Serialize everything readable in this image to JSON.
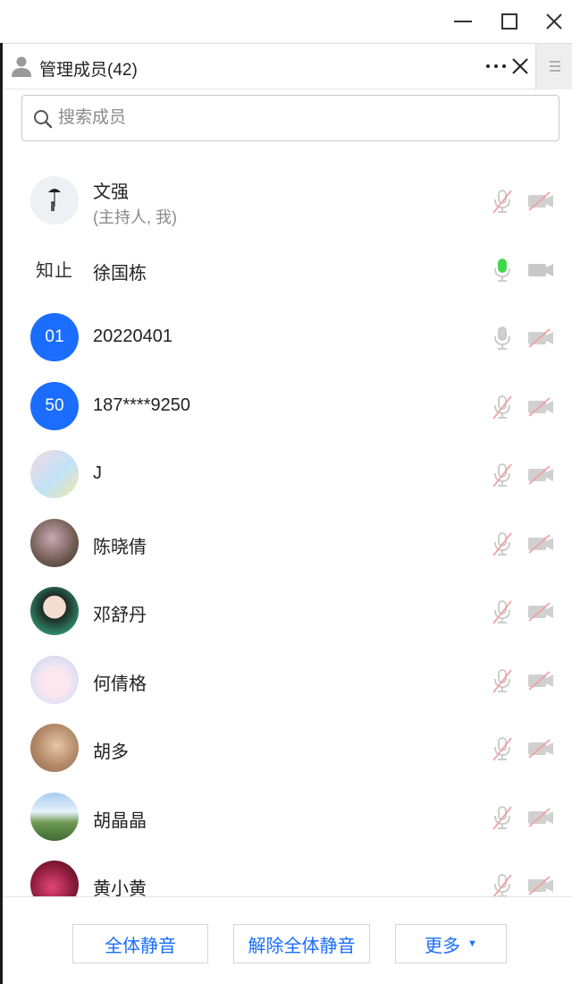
{
  "window": {
    "minimize_icon": "minimize-icon",
    "maximize_icon": "maximize-icon",
    "close_icon": "close-icon"
  },
  "header": {
    "title": "管理成员(42)",
    "user_icon": "user-icon",
    "more_icon": "more-horizontal-icon",
    "close_icon": "close-icon",
    "side_icon": "menu-icon"
  },
  "search": {
    "placeholder": "搜索成员",
    "value": "",
    "icon": "search-icon"
  },
  "members": [
    {
      "name": "文强",
      "sub": "(主持人, 我)",
      "mic": "muted",
      "camera": "off"
    },
    {
      "name": "徐国栋",
      "avatar_text": "知止",
      "mic": "active",
      "camera": "on"
    },
    {
      "name": "20220401",
      "avatar_text": "01",
      "mic": "on",
      "camera": "off"
    },
    {
      "name": "187****9250",
      "avatar_text": "50",
      "mic": "muted",
      "camera": "off"
    },
    {
      "name": "J",
      "mic": "muted",
      "camera": "off"
    },
    {
      "name": "陈晓倩",
      "mic": "muted",
      "camera": "off"
    },
    {
      "name": "邓舒丹",
      "mic": "muted",
      "camera": "off"
    },
    {
      "name": "何倩格",
      "mic": "muted",
      "camera": "off"
    },
    {
      "name": "胡多",
      "mic": "muted",
      "camera": "off"
    },
    {
      "name": "胡晶晶",
      "mic": "muted",
      "camera": "off"
    },
    {
      "name": "黄小黄",
      "mic": "muted",
      "camera": "off"
    }
  ],
  "footer": {
    "mute_all": "全体静音",
    "unmute_all": "解除全体静音",
    "more": "更多"
  },
  "colors": {
    "accent": "#1a6dff",
    "muted_red": "#f0a0a0",
    "mic_active": "#3fd84a",
    "icon_gray": "#c8c8c8"
  }
}
